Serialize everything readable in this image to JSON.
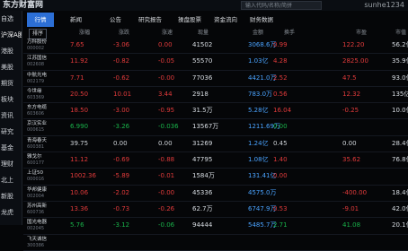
{
  "app": {
    "logo": "东方财富网",
    "search_placeholder": "输入代码/名称/简拼",
    "user": "sunhe1234"
  },
  "sidebar": {
    "items": [
      "自选",
      "沪深A股",
      "港股",
      "美股",
      "期货",
      "板块",
      "资讯",
      "研究",
      "基金",
      "理财",
      "北上",
      "新股",
      "龙虎",
      "设置"
    ]
  },
  "tabs": [
    "行情",
    "新闻",
    "公告",
    "研究报告",
    "操盘股票",
    "资金流向",
    "财务数据"
  ],
  "header": {
    "sort_label": "排序",
    "columns": [
      "涨幅",
      "涨跌",
      "涨速",
      "现量",
      "金额",
      "换手",
      "市盈",
      "市值"
    ]
  },
  "rows": [
    {
      "name": "万科股份",
      "code": "000002",
      "chg": "7.65",
      "amt": "-3.06",
      "spd": "0.00",
      "vol": "41502",
      "money": "3068.6万",
      "turn": "0.99",
      "pe": "122.20",
      "mcap": "56.2亿",
      "dir": "up"
    },
    {
      "name": "江苏国信",
      "code": "002608",
      "chg": "11.92",
      "amt": "-0.82",
      "spd": "-0.05",
      "vol": "55570",
      "money": "1.03亿",
      "turn": "4.28",
      "pe": "2825.00",
      "mcap": "35.9亿",
      "dir": "up"
    },
    {
      "name": "中航光电",
      "code": "002179",
      "chg": "7.71",
      "amt": "-0.62",
      "spd": "-0.00",
      "vol": "77036",
      "money": "4421.0万",
      "turn": "2.52",
      "pe": "47.5",
      "mcap": "93.0亿",
      "dir": "up"
    },
    {
      "name": "今世缘",
      "code": "603369",
      "chg": "20.50",
      "amt": "10.01",
      "spd": "3.44",
      "vol": "2918",
      "money": "783.0万",
      "turn": "0.56",
      "pe": "12.32",
      "mcap": "135亿",
      "dir": "up"
    },
    {
      "name": "东方电缆",
      "code": "603606",
      "chg": "18.50",
      "amt": "-3.00",
      "spd": "-0.95",
      "vol": "31.5万",
      "money": "5.28亿",
      "turn": "16.04",
      "pe": "-0.25",
      "mcap": "10.0亿",
      "dir": "up"
    },
    {
      "name": "京汉实业",
      "code": "000615",
      "chg": "6.990",
      "amt": "-3.26",
      "spd": "-0.036",
      "vol": "13567万",
      "money": "1211.69万",
      "turn": "0.00",
      "pe": "",
      "mcap": "",
      "dir": "down"
    },
    {
      "name": "青海春天",
      "code": "600381",
      "chg": "39.75",
      "amt": "0.00",
      "spd": "0.00",
      "vol": "31269",
      "money": "1.24亿",
      "turn": "0.45",
      "pe": "0.00",
      "mcap": "28.4亿",
      "dir": "flat"
    },
    {
      "name": "雅戈尔",
      "code": "600177",
      "chg": "11.12",
      "amt": "-0.69",
      "spd": "-0.88",
      "vol": "47795",
      "money": "1.08亿",
      "turn": "1.40",
      "pe": "35.62",
      "mcap": "76.8亿",
      "dir": "up"
    },
    {
      "name": "上证50",
      "code": "000016",
      "chg": "1002.36",
      "amt": "-5.89",
      "spd": "-0.01",
      "vol": "1584万",
      "money": "131.41亿",
      "turn": "0.00",
      "pe": "",
      "mcap": "",
      "dir": "up"
    },
    {
      "name": "华邦健康",
      "code": "002004",
      "chg": "10.06",
      "amt": "-2.02",
      "spd": "-0.00",
      "vol": "45336",
      "money": "4575.0万",
      "turn": "",
      "pe": "-400.00",
      "mcap": "18.4亿",
      "dir": "up"
    },
    {
      "name": "苏州高新",
      "code": "600736",
      "chg": "13.36",
      "amt": "-0.73",
      "spd": "-0.26",
      "vol": "62.7万",
      "money": "6747.9万",
      "turn": "0.53",
      "pe": "-9.01",
      "mcap": "42.0亿",
      "dir": "up"
    },
    {
      "name": "国光电器",
      "code": "002045",
      "chg": "5.76",
      "amt": "-3.12",
      "spd": "-0.06",
      "vol": "94444",
      "money": "5485.7万",
      "turn": "2.71",
      "pe": "41.08",
      "mcap": "20.1亿",
      "dir": "down"
    },
    {
      "name": "飞天诚信",
      "code": "300386",
      "chg": "",
      "amt": "",
      "spd": "",
      "vol": "",
      "money": "",
      "turn": "",
      "pe": "",
      "mcap": "",
      "dir": "up"
    }
  ],
  "colors": {
    "up": "#e23b3b",
    "down": "#19b34a",
    "accent": "#2c6fd6",
    "background": "#050608"
  }
}
